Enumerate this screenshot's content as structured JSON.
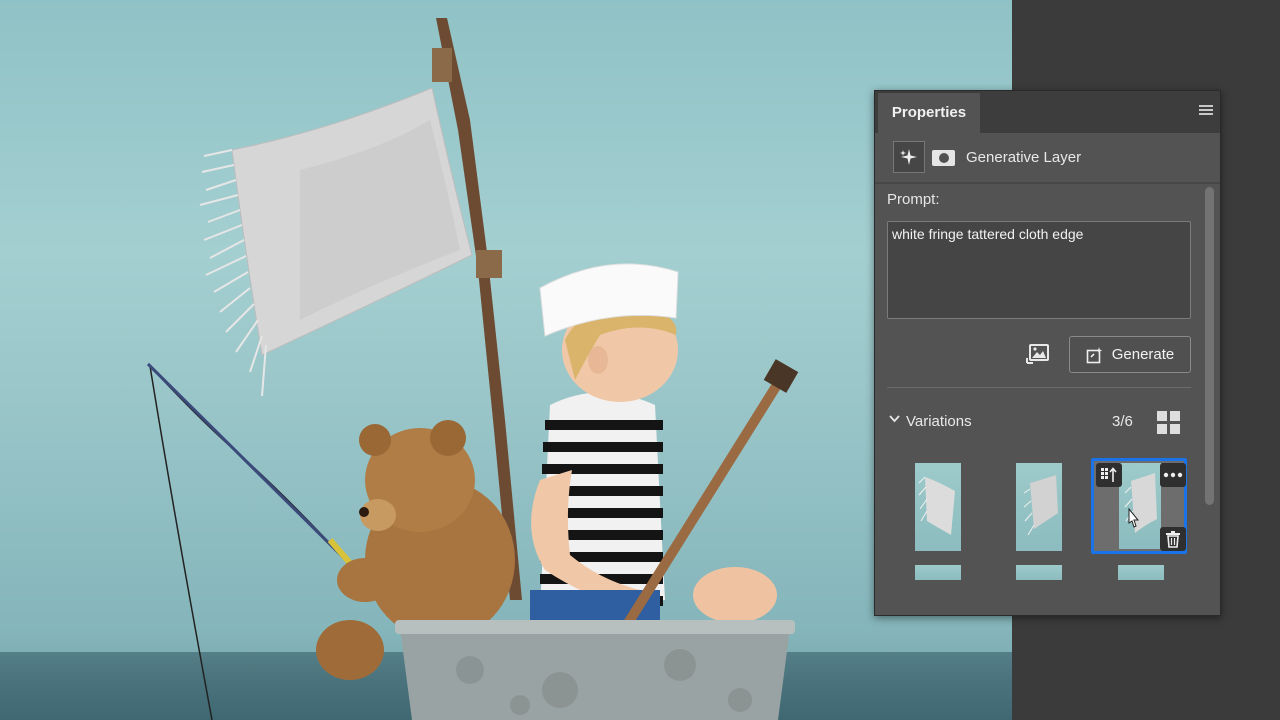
{
  "panel": {
    "tab_title": "Properties",
    "layer_name": "Generative Layer",
    "prompt_label": "Prompt:",
    "prompt_value": "white fringe tattered cloth edge",
    "generate_label": "Generate",
    "variations_label": "Variations",
    "variations_count": "3/6",
    "selected_variation": 3
  },
  "icons": {
    "panel_menu": "hamburger-menu-icon",
    "layer_type": "generative-sparkle-icon",
    "mask": "layer-mask-icon",
    "reference_image": "reference-image-icon",
    "generate": "generate-sparkle-icon",
    "collapse": "chevron-down-icon",
    "grid_view": "grid-view-icon",
    "make_layer": "new-layer-from-variation-icon",
    "more": "more-options-icon",
    "delete": "trash-icon"
  },
  "colors": {
    "panel_bg": "#535353",
    "header_bg": "#3d3d3d",
    "selection": "#1a73e8",
    "sky": "#9ec9cc",
    "sea": "#4a737d"
  }
}
